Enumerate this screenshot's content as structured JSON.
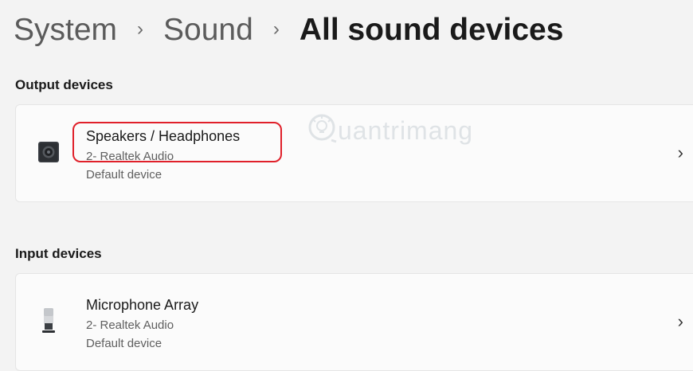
{
  "breadcrumb": {
    "items": [
      "System",
      "Sound",
      "All sound devices"
    ],
    "separator": "›"
  },
  "sections": {
    "output": {
      "label": "Output devices",
      "device": {
        "name": "Speakers / Headphones",
        "driver": "2- Realtek Audio",
        "status": "Default device",
        "icon": "speaker-icon",
        "chevron": "›"
      }
    },
    "input": {
      "label": "Input devices",
      "device": {
        "name": "Microphone Array",
        "driver": "2- Realtek Audio",
        "status": "Default device",
        "icon": "microphone-icon",
        "chevron": "›"
      }
    }
  },
  "watermark": {
    "text": "uantrimang"
  },
  "colors": {
    "highlight": "#e0202a",
    "background": "#f3f3f3",
    "card": "#fbfbfb"
  }
}
